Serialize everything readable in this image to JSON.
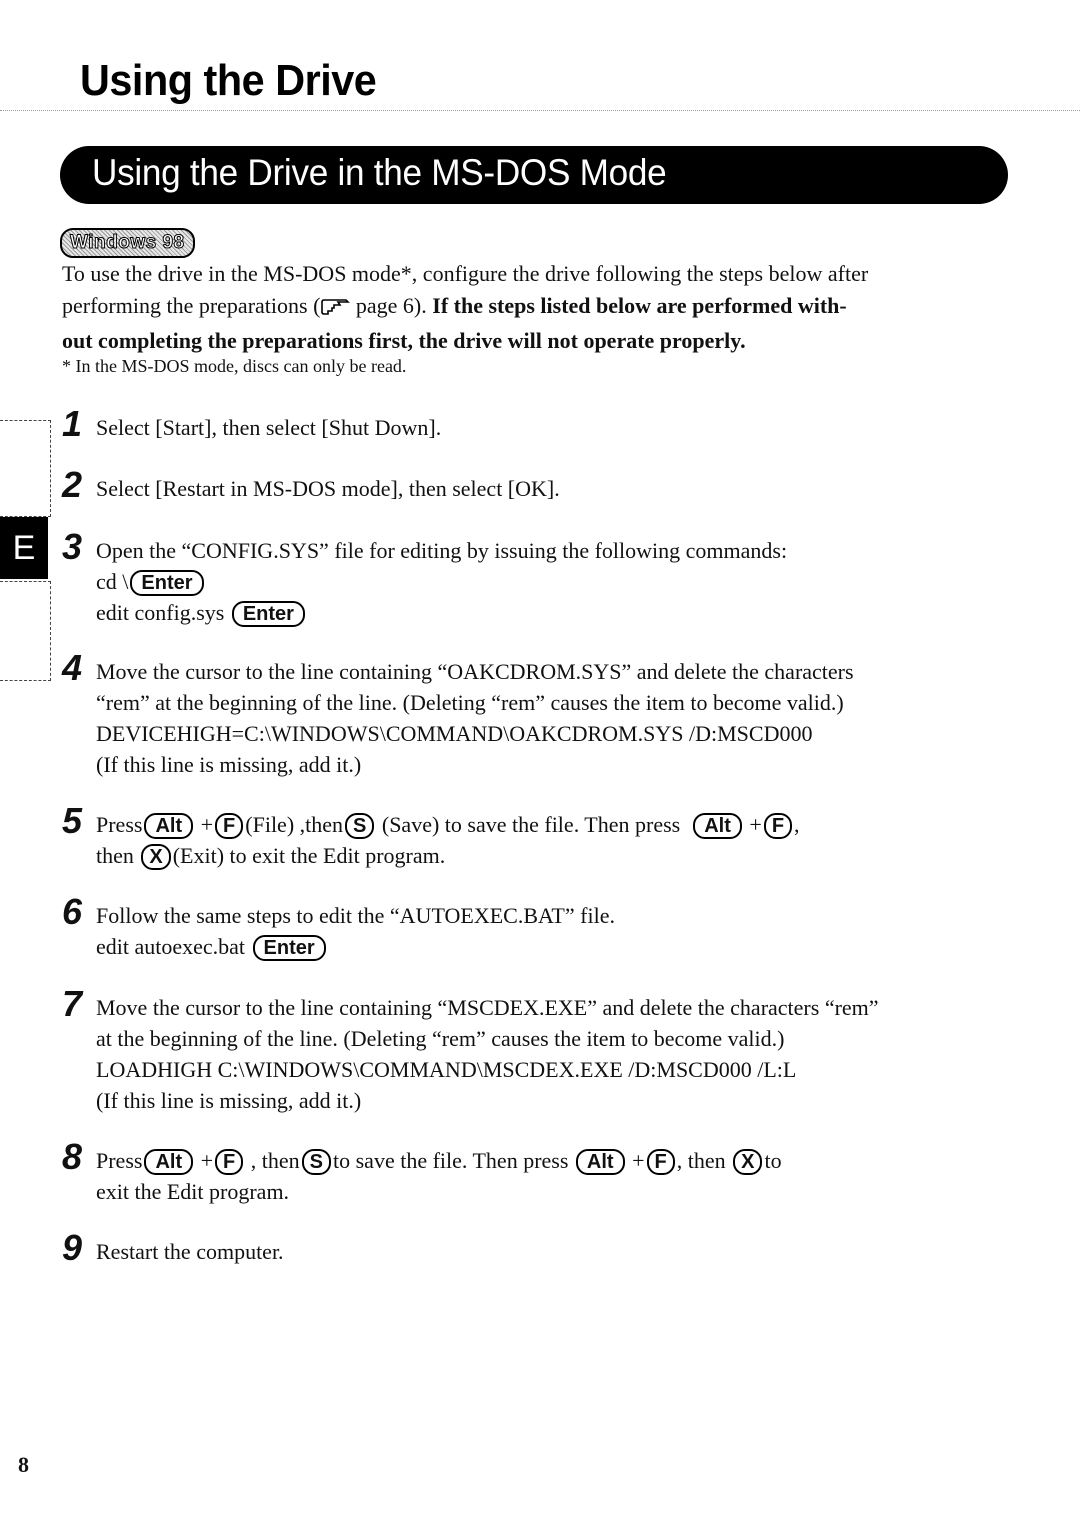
{
  "page": {
    "section_title": "Using the Drive",
    "banner_title": "Using the Drive in the MS-DOS Mode",
    "os_badge": "Windows 98",
    "side_tab_letter": "E",
    "page_number": "8"
  },
  "intro": {
    "line1": "To use the drive in the MS-DOS mode*, configure the drive following the steps below after",
    "line2_pre": "performing the preparations (",
    "line2_ref": " page 6).",
    "line2_bold": " If the steps listed below are performed with-",
    "line3_bold": "out completing the preparations first, the drive will not operate properly.",
    "footnote": "* In the MS-DOS mode, discs can only be read.",
    "pointer_icon": "pointing-hand-icon"
  },
  "keys": {
    "enter": "Enter",
    "alt": "Alt",
    "f": "F",
    "s": "S",
    "x": "X"
  },
  "steps": [
    {
      "num": "1",
      "text": "Select [Start], then select [Shut Down]."
    },
    {
      "num": "2",
      "text": "Select [Restart in MS-DOS mode], then select [OK]."
    },
    {
      "num": "3",
      "text": "Open the “CONFIG.SYS” file for editing by issuing the following commands:",
      "cmd1": "cd \\",
      "cmd2": "edit config.sys"
    },
    {
      "num": "4",
      "line1": "Move the cursor to the line containing “OAKCDROM.SYS” and delete the characters",
      "line2": "“rem” at the beginning of the line. (Deleting “rem” causes the item to become valid.)",
      "line3": "DEVICEHIGH=C:\\WINDOWS\\COMMAND\\OAKCDROM.SYS /D:MSCD000",
      "line4": "(If this line is missing, add it.)"
    },
    {
      "num": "5",
      "t1": "Press",
      "t2": "+",
      "t3": "(File) ,then",
      "t4": " (Save) to save the file.  Then press ",
      "t5": "+",
      "t6": ",",
      "t7": "then",
      "t8": "(Exit) to exit the Edit program."
    },
    {
      "num": "6",
      "text": "Follow the same steps to edit the “AUTOEXEC.BAT” file.",
      "cmd": "edit autoexec.bat"
    },
    {
      "num": "7",
      "line1": "Move the cursor to the line containing “MSCDEX.EXE” and delete the characters “rem”",
      "line2": "at the beginning of the line. (Deleting “rem” causes the item to become valid.)",
      "line3": "LOADHIGH  C:\\WINDOWS\\COMMAND\\MSCDEX.EXE /D:MSCD000 /L:L",
      "line4": "(If this line is missing, add it.)"
    },
    {
      "num": "8",
      "t1": "Press",
      "t2": "+",
      "t3": ", then",
      "t4": "to save the file.  Then press ",
      "t5": "+",
      "t6": ", then",
      "t7": "to",
      "line2": "exit the Edit program."
    },
    {
      "num": "9",
      "text": "Restart the computer."
    }
  ]
}
